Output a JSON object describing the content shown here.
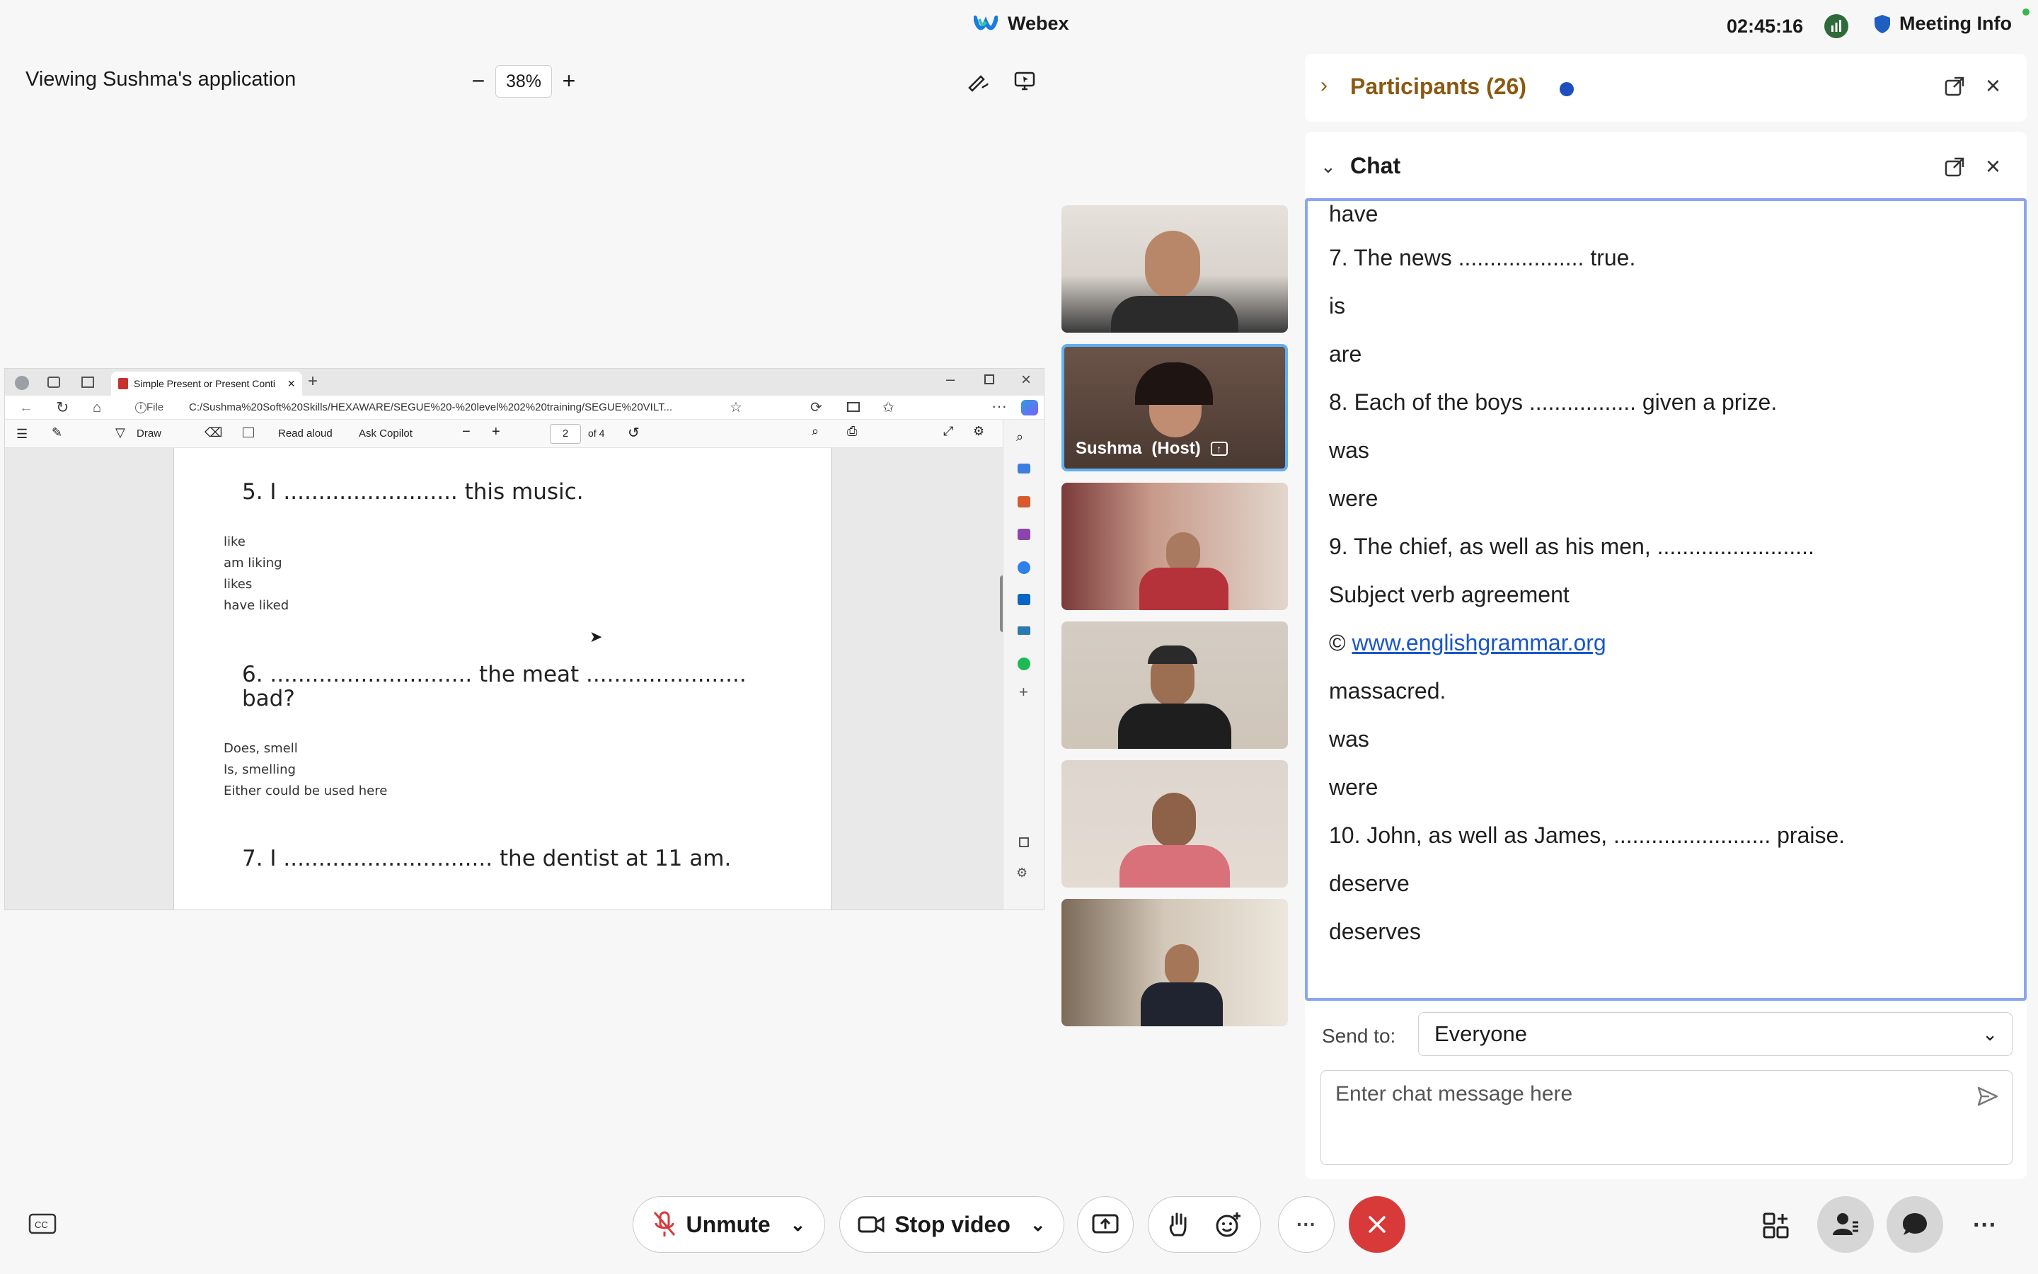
{
  "app": {
    "name": "Webex",
    "clock": "02:45:16",
    "meeting_info": "Meeting Info"
  },
  "viewing": {
    "label": "Viewing Sushma's application",
    "zoom": "38%",
    "zoom_minus": "−",
    "zoom_plus": "+"
  },
  "browser": {
    "tab_title": "Simple Present or Present Conti",
    "file_label": "File",
    "url": "C:/Sushma%20Soft%20Skills/HEXAWARE/SEGUE%20-%20level%202%20training/SEGUE%20VILT...",
    "toolbar": {
      "draw": "Draw",
      "read_aloud": "Read aloud",
      "ask_copilot": "Ask Copilot",
      "page": "2",
      "of_pages": "of 4"
    }
  },
  "pdf": {
    "q5": "5. I ......................... this music.",
    "q5_options": [
      "like",
      "am liking",
      "likes",
      "have liked"
    ],
    "q6_line1": "6. ............................. the meat .......................",
    "q6_line2": "bad?",
    "q6_options": [
      "Does, smell",
      "Is, smelling",
      "Either could be used here"
    ],
    "q7": "7. I .............................. the dentist at 11 am."
  },
  "tiles": {
    "host_name": "Sushma",
    "host_role": "(Host)"
  },
  "participants": {
    "title": "Participants (26)"
  },
  "chat": {
    "title": "Chat",
    "messages": [
      "have",
      "7. The news .................... true.",
      "is",
      "are",
      "8. Each of the boys ................. given a prize.",
      "was",
      "were",
      "9. The chief, as well as his men, .........................",
      "Subject verb agreement",
      "massacred.",
      "was",
      "were",
      "10. John, as well as James, ......................... praise.",
      "deserve",
      "deserves"
    ],
    "copyright_symbol": "©",
    "link": "www.englishgrammar.org",
    "send_to_label": "Send to:",
    "send_to_value": "Everyone",
    "input_placeholder": "Enter chat message here"
  },
  "controls": {
    "unmute": "Unmute",
    "stop_video": "Stop video",
    "more": "···"
  },
  "colors": {
    "accent_blue": "#5fb0f2",
    "leave_red": "#d83a3a",
    "participants_brown": "#8a5a12",
    "link_blue": "#1a56c8"
  }
}
